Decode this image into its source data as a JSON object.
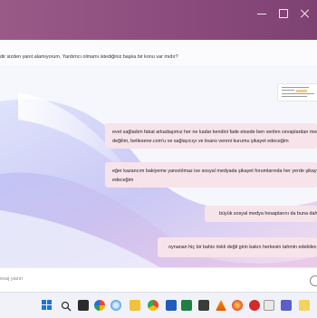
{
  "chat": {
    "top_message": "dir sizden yanıt alamıyorum. Yardımcı olmamı istediğiniz başka bir konu var mıdır?",
    "messages": [
      {
        "line1": "evet sağladım fakat arkadaşımız her ne kadar kendini fade etsede ben verilen cevaplardan mem",
        "line2": "değilim, betlesene.com'u ve sağlayıcıyı ve lisans vereni kurumu şikayet edeceğim"
      },
      {
        "line1": "eğer kazancım bakiyeme yansıtılmaz ise sosyal medyada şikayet forumlarında her yerde şikayet",
        "line2": "edeceğim"
      },
      {
        "line1": "büyük sosyal medya hesaplarını da buna dahil ed"
      },
      {
        "line1": "oynanan hiç bir bahis riskli değil girin bakın herkesin tahmin edebileceği"
      }
    ]
  },
  "input": {
    "placeholder": "esaj yazın"
  },
  "taskbar": {
    "icons": [
      "windows-start",
      "search",
      "task-view",
      "widgets",
      "edge",
      "chrome",
      "file-explorer",
      "word",
      "excel",
      "store",
      "vlc",
      "firefox",
      "opera",
      "acrobat",
      "generic-app",
      "settings",
      "teams",
      "notes"
    ]
  },
  "colors": {
    "titlebar": "#8a4a7c",
    "bubble": "#f7e3ea",
    "accent": "#1877d8"
  }
}
